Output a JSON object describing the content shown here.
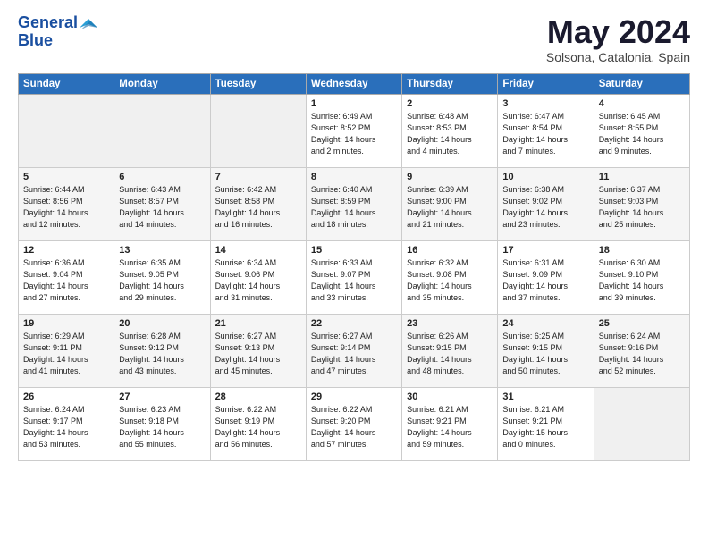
{
  "logo": {
    "line1": "General",
    "line2": "Blue"
  },
  "title": "May 2024",
  "subtitle": "Solsona, Catalonia, Spain",
  "header_days": [
    "Sunday",
    "Monday",
    "Tuesday",
    "Wednesday",
    "Thursday",
    "Friday",
    "Saturday"
  ],
  "weeks": [
    [
      {
        "num": "",
        "info": ""
      },
      {
        "num": "",
        "info": ""
      },
      {
        "num": "",
        "info": ""
      },
      {
        "num": "1",
        "info": "Sunrise: 6:49 AM\nSunset: 8:52 PM\nDaylight: 14 hours\nand 2 minutes."
      },
      {
        "num": "2",
        "info": "Sunrise: 6:48 AM\nSunset: 8:53 PM\nDaylight: 14 hours\nand 4 minutes."
      },
      {
        "num": "3",
        "info": "Sunrise: 6:47 AM\nSunset: 8:54 PM\nDaylight: 14 hours\nand 7 minutes."
      },
      {
        "num": "4",
        "info": "Sunrise: 6:45 AM\nSunset: 8:55 PM\nDaylight: 14 hours\nand 9 minutes."
      }
    ],
    [
      {
        "num": "5",
        "info": "Sunrise: 6:44 AM\nSunset: 8:56 PM\nDaylight: 14 hours\nand 12 minutes."
      },
      {
        "num": "6",
        "info": "Sunrise: 6:43 AM\nSunset: 8:57 PM\nDaylight: 14 hours\nand 14 minutes."
      },
      {
        "num": "7",
        "info": "Sunrise: 6:42 AM\nSunset: 8:58 PM\nDaylight: 14 hours\nand 16 minutes."
      },
      {
        "num": "8",
        "info": "Sunrise: 6:40 AM\nSunset: 8:59 PM\nDaylight: 14 hours\nand 18 minutes."
      },
      {
        "num": "9",
        "info": "Sunrise: 6:39 AM\nSunset: 9:00 PM\nDaylight: 14 hours\nand 21 minutes."
      },
      {
        "num": "10",
        "info": "Sunrise: 6:38 AM\nSunset: 9:02 PM\nDaylight: 14 hours\nand 23 minutes."
      },
      {
        "num": "11",
        "info": "Sunrise: 6:37 AM\nSunset: 9:03 PM\nDaylight: 14 hours\nand 25 minutes."
      }
    ],
    [
      {
        "num": "12",
        "info": "Sunrise: 6:36 AM\nSunset: 9:04 PM\nDaylight: 14 hours\nand 27 minutes."
      },
      {
        "num": "13",
        "info": "Sunrise: 6:35 AM\nSunset: 9:05 PM\nDaylight: 14 hours\nand 29 minutes."
      },
      {
        "num": "14",
        "info": "Sunrise: 6:34 AM\nSunset: 9:06 PM\nDaylight: 14 hours\nand 31 minutes."
      },
      {
        "num": "15",
        "info": "Sunrise: 6:33 AM\nSunset: 9:07 PM\nDaylight: 14 hours\nand 33 minutes."
      },
      {
        "num": "16",
        "info": "Sunrise: 6:32 AM\nSunset: 9:08 PM\nDaylight: 14 hours\nand 35 minutes."
      },
      {
        "num": "17",
        "info": "Sunrise: 6:31 AM\nSunset: 9:09 PM\nDaylight: 14 hours\nand 37 minutes."
      },
      {
        "num": "18",
        "info": "Sunrise: 6:30 AM\nSunset: 9:10 PM\nDaylight: 14 hours\nand 39 minutes."
      }
    ],
    [
      {
        "num": "19",
        "info": "Sunrise: 6:29 AM\nSunset: 9:11 PM\nDaylight: 14 hours\nand 41 minutes."
      },
      {
        "num": "20",
        "info": "Sunrise: 6:28 AM\nSunset: 9:12 PM\nDaylight: 14 hours\nand 43 minutes."
      },
      {
        "num": "21",
        "info": "Sunrise: 6:27 AM\nSunset: 9:13 PM\nDaylight: 14 hours\nand 45 minutes."
      },
      {
        "num": "22",
        "info": "Sunrise: 6:27 AM\nSunset: 9:14 PM\nDaylight: 14 hours\nand 47 minutes."
      },
      {
        "num": "23",
        "info": "Sunrise: 6:26 AM\nSunset: 9:15 PM\nDaylight: 14 hours\nand 48 minutes."
      },
      {
        "num": "24",
        "info": "Sunrise: 6:25 AM\nSunset: 9:15 PM\nDaylight: 14 hours\nand 50 minutes."
      },
      {
        "num": "25",
        "info": "Sunrise: 6:24 AM\nSunset: 9:16 PM\nDaylight: 14 hours\nand 52 minutes."
      }
    ],
    [
      {
        "num": "26",
        "info": "Sunrise: 6:24 AM\nSunset: 9:17 PM\nDaylight: 14 hours\nand 53 minutes."
      },
      {
        "num": "27",
        "info": "Sunrise: 6:23 AM\nSunset: 9:18 PM\nDaylight: 14 hours\nand 55 minutes."
      },
      {
        "num": "28",
        "info": "Sunrise: 6:22 AM\nSunset: 9:19 PM\nDaylight: 14 hours\nand 56 minutes."
      },
      {
        "num": "29",
        "info": "Sunrise: 6:22 AM\nSunset: 9:20 PM\nDaylight: 14 hours\nand 57 minutes."
      },
      {
        "num": "30",
        "info": "Sunrise: 6:21 AM\nSunset: 9:21 PM\nDaylight: 14 hours\nand 59 minutes."
      },
      {
        "num": "31",
        "info": "Sunrise: 6:21 AM\nSunset: 9:21 PM\nDaylight: 15 hours\nand 0 minutes."
      },
      {
        "num": "",
        "info": ""
      }
    ]
  ]
}
